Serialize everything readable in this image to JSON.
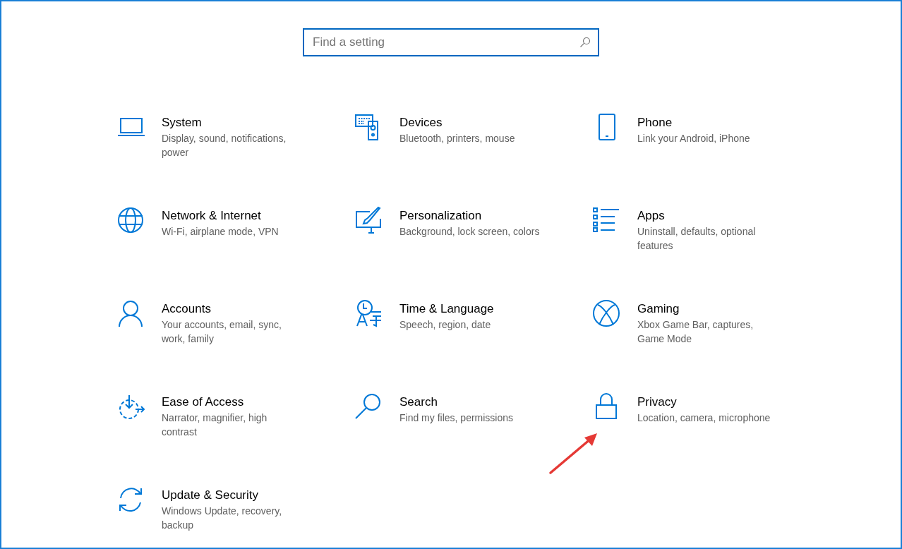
{
  "search": {
    "placeholder": "Find a setting"
  },
  "categories": [
    {
      "title": "System",
      "description": "Display, sound, notifications, power"
    },
    {
      "title": "Devices",
      "description": "Bluetooth, printers, mouse"
    },
    {
      "title": "Phone",
      "description": "Link your Android, iPhone"
    },
    {
      "title": "Network & Internet",
      "description": "Wi-Fi, airplane mode, VPN"
    },
    {
      "title": "Personalization",
      "description": "Background, lock screen, colors"
    },
    {
      "title": "Apps",
      "description": "Uninstall, defaults, optional features"
    },
    {
      "title": "Accounts",
      "description": "Your accounts, email, sync, work, family"
    },
    {
      "title": "Time & Language",
      "description": "Speech, region, date"
    },
    {
      "title": "Gaming",
      "description": "Xbox Game Bar, captures, Game Mode"
    },
    {
      "title": "Ease of Access",
      "description": "Narrator, magnifier, high contrast"
    },
    {
      "title": "Search",
      "description": "Find my files, permissions"
    },
    {
      "title": "Privacy",
      "description": "Location, camera, microphone"
    },
    {
      "title": "Update & Security",
      "description": "Windows Update, recovery, backup"
    }
  ]
}
